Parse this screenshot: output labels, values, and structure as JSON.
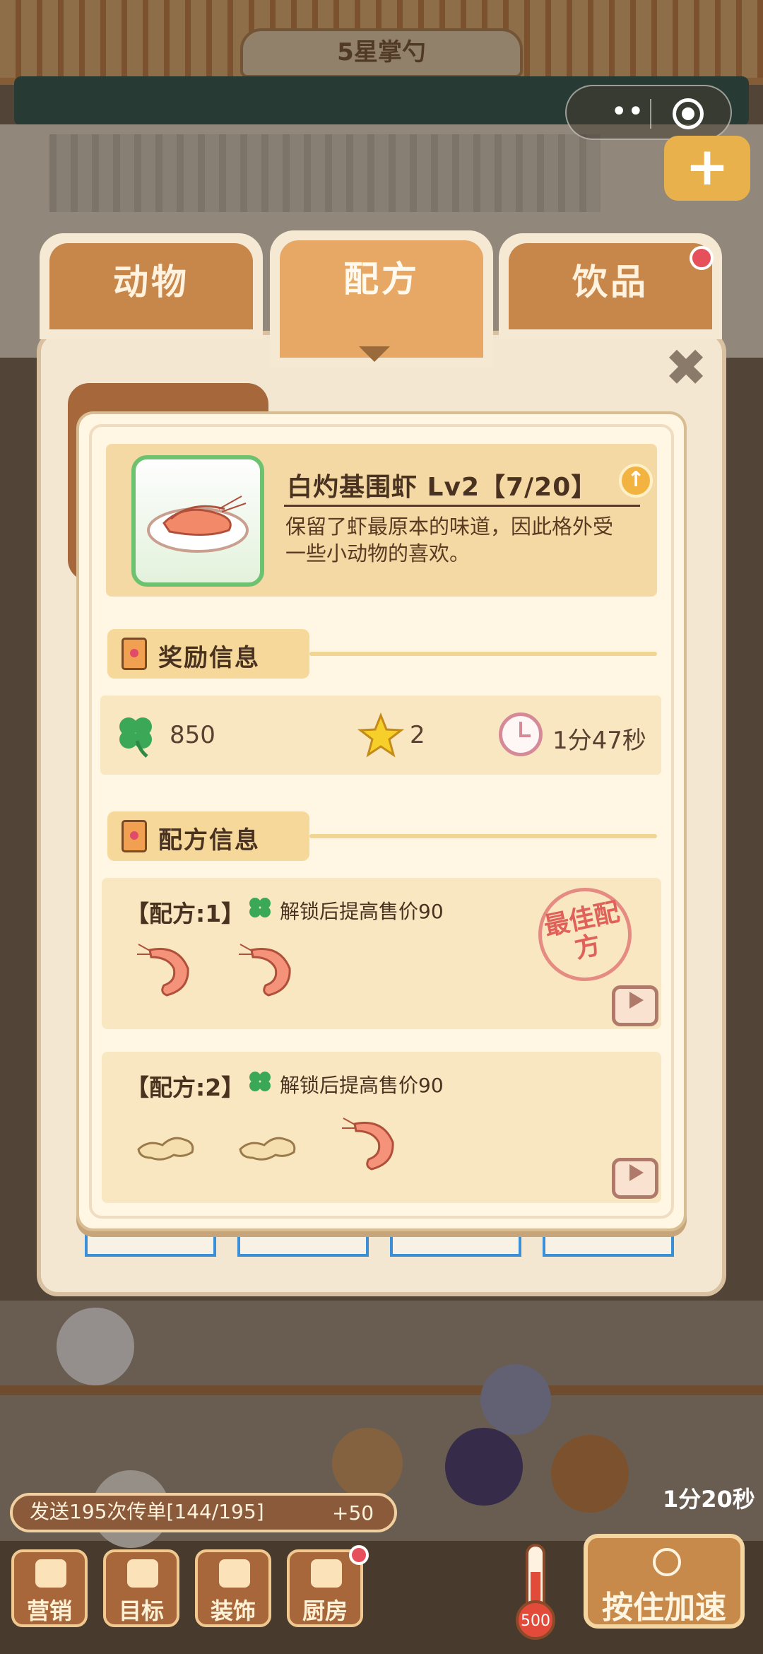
{
  "shop": {
    "rating_sign": "5星掌勺"
  },
  "colors": {
    "panel": "#f3e7d2",
    "accent": "#e8a865",
    "clover": "#3aa857",
    "star": "#f6cf2a"
  },
  "system": {
    "more_icon": "••",
    "target_icon": "record-icon"
  },
  "tabs": [
    {
      "label": "动物",
      "active": false
    },
    {
      "label": "配方",
      "active": true
    },
    {
      "label": "饮品",
      "active": false,
      "has_badge": true
    }
  ],
  "dish": {
    "name": "白灼基围虾 Lv2【7/20】",
    "description": "保留了虾最原本的味道，因此格外受一些小动物的喜欢。"
  },
  "reward_section": {
    "title": "奖励信息",
    "clover": "850",
    "stars": "2",
    "time": "1分47秒"
  },
  "recipe_section": {
    "title": "配方信息",
    "recipes": [
      {
        "label": "【配方:1】",
        "unlock": "解锁后提高售价90",
        "ingredients": [
          "shrimp",
          "shrimp"
        ],
        "best": true,
        "best_stamp": "最佳配方"
      },
      {
        "label": "【配方:2】",
        "unlock": "解锁后提高售价90",
        "ingredients": [
          "ginger",
          "ginger",
          "shrimp"
        ],
        "best": false
      }
    ]
  },
  "quest": {
    "text": "发送195次传单[144/195]",
    "bonus": "+50"
  },
  "bottom_nav": [
    {
      "label": "营销",
      "icon": "megaphone-icon"
    },
    {
      "label": "目标",
      "icon": "target-icon"
    },
    {
      "label": "装饰",
      "icon": "paint-roller-icon"
    },
    {
      "label": "厨房",
      "icon": "cooking-pot-icon",
      "has_badge": true
    }
  ],
  "heat": "500",
  "speed_button": "按住加速",
  "timer": "1分20秒"
}
